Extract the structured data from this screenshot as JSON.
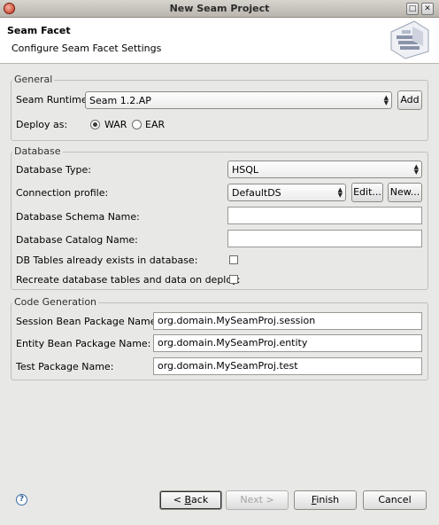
{
  "window": {
    "title": "New Seam Project"
  },
  "header": {
    "title": "Seam Facet",
    "subtitle": "Configure Seam Facet Settings"
  },
  "general": {
    "group_label": "General",
    "runtime_label": "Seam Runtime",
    "runtime_value": "Seam 1.2.AP",
    "add_label": "Add",
    "deploy_label": "Deploy as:",
    "deploy_options": [
      {
        "label": "WAR",
        "checked": true
      },
      {
        "label": "EAR",
        "checked": false
      }
    ]
  },
  "database": {
    "group_label": "Database",
    "type_label": "Database Type:",
    "type_value": "HSQL",
    "profile_label": "Connection profile:",
    "profile_value": "DefaultDS",
    "edit_label": "Edit...",
    "new_label": "New...",
    "schema_label": "Database Schema Name:",
    "schema_value": "",
    "catalog_label": "Database Catalog Name:",
    "catalog_value": "",
    "tables_exist_label": "DB Tables already exists in database:",
    "tables_exist_checked": false,
    "recreate_label": "Recreate database tables and data on deploy:",
    "recreate_checked": false
  },
  "codegen": {
    "group_label": "Code Generation",
    "session_label": "Session Bean Package Name:",
    "session_value": "org.domain.MySeamProj.session",
    "entity_label": "Entity Bean Package Name:",
    "entity_value": "org.domain.MySeamProj.entity",
    "test_label": "Test Package Name:",
    "test_value": "org.domain.MySeamProj.test"
  },
  "footer": {
    "help_icon": "?",
    "back_pre": "< ",
    "back_mnemonic": "B",
    "back_post": "ack",
    "next_label": "Next >",
    "finish_mnemonic": "F",
    "finish_post": "inish",
    "cancel_label": "Cancel"
  },
  "colors": {
    "window_bg": "#e8e8e7",
    "header_bg": "#ffffff",
    "help_blue": "#2f5e93"
  }
}
